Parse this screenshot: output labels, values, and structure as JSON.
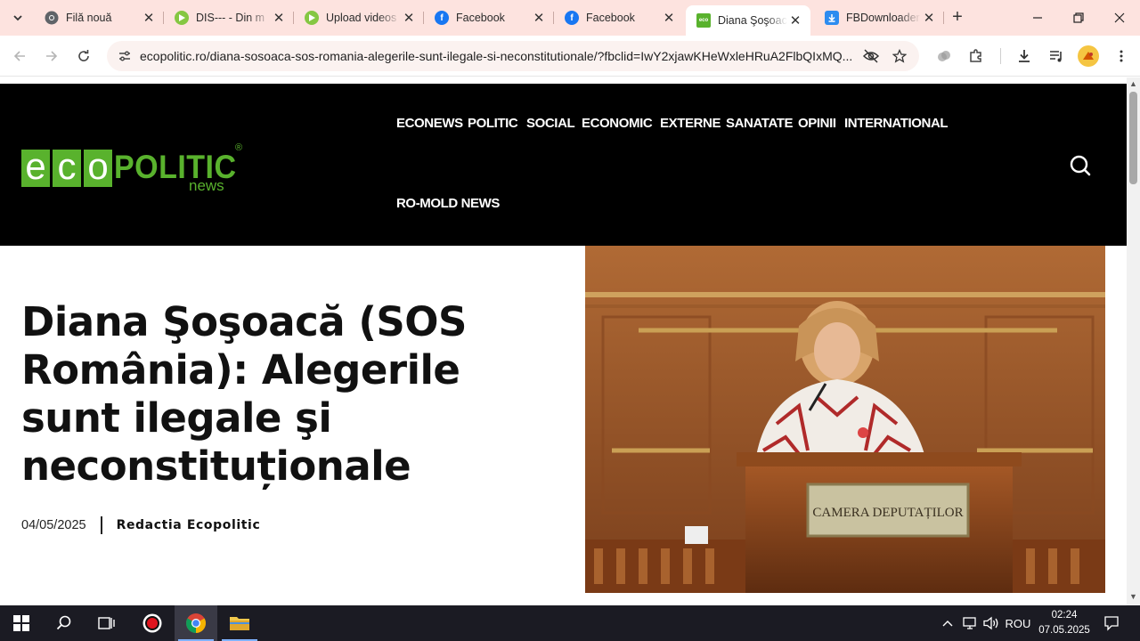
{
  "browser": {
    "tabs": [
      {
        "title": "Filă nouă",
        "favicon": "chrome-icon",
        "active": false
      },
      {
        "title": "DIS--- - Din m",
        "favicon": "rumble-play-icon",
        "active": false
      },
      {
        "title": "Upload videos",
        "favicon": "rumble-play-icon",
        "active": false
      },
      {
        "title": "Facebook",
        "favicon": "facebook-icon",
        "active": false
      },
      {
        "title": "Facebook",
        "favicon": "facebook-icon",
        "active": false
      },
      {
        "title": "Diana Şoşoacă",
        "favicon": "ecopolitic-icon",
        "active": true
      },
      {
        "title": "FBDownloader",
        "favicon": "download-icon",
        "active": false
      }
    ],
    "url": "ecopolitic.ro/diana-sosoaca-sos-romania-alegerile-sunt-ilegale-si-neconstitutionale/?fbclid=IwY2xjawKHeWxleHRuA2FlbQIxMQ...",
    "colors": {
      "tabstrip": "#fde3df",
      "omnibox": "#fbf2f0"
    }
  },
  "site": {
    "logo": {
      "part1": "e",
      "part2": "c",
      "part3": "o",
      "politic": "POLITIC",
      "news": "news",
      "reg": "®"
    },
    "nav": {
      "econews": "ECONEWS",
      "politic": "POLITIC",
      "social": "SOCIAL",
      "economic": "ECONOMIC",
      "externe": "EXTERNE",
      "sanatate": "SANATATE",
      "opinii": "OPINII",
      "international": "INTERNATIONAL",
      "romold": "RO-MOLD NEWS"
    },
    "colors": {
      "header_bg": "#000000",
      "brand_green": "#59b22d"
    }
  },
  "article": {
    "title": "Diana Şoşoacă (SOS România): Alegerile sunt ilegale şi neconstituționale",
    "date": "04/05/2025",
    "author": "Redactia Ecopolitic",
    "image_caption_plate": "CAMERA DEPUTAȚILOR"
  },
  "taskbar": {
    "language": "ROU",
    "time": "02:24",
    "date": "07.05.2025"
  }
}
